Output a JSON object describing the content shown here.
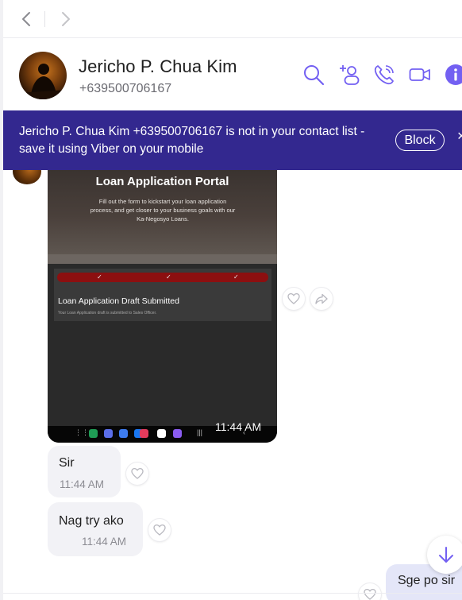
{
  "contact": {
    "name": "Jericho P. Chua Kim",
    "phone": "+639500706167"
  },
  "banner": {
    "text": "Jericho P. Chua Kim +639500706167 is not in your contact list - save it using Viber on your mobile",
    "block_label": "Block",
    "close_glyph": "×"
  },
  "header_icons": [
    "search-icon",
    "add-participant-icon",
    "call-icon",
    "video-call-icon",
    "info-icon"
  ],
  "image_message": {
    "title": "Loan Application Portal",
    "subtitle": "Fill out the form to kickstart your loan application process, and get closer to your business goals with our Ka-Negosyo Loans.",
    "card_title": "Loan Application Draft Submitted",
    "card_sub": "Your Loan Application draft is submitted to Sales Officer.",
    "time": "11:44 AM",
    "tick": "✓"
  },
  "messages": [
    {
      "text": "Sir",
      "time": "11:44 AM"
    },
    {
      "text": "Nag try ako",
      "time": "11:44 AM"
    }
  ],
  "outgoing": {
    "text": "Sge po sir"
  },
  "colors": {
    "accent": "#7360f2",
    "banner_bg": "#33288f",
    "incoming_bubble": "#f2f2f6",
    "outgoing_bubble": "#e4e6f8"
  }
}
